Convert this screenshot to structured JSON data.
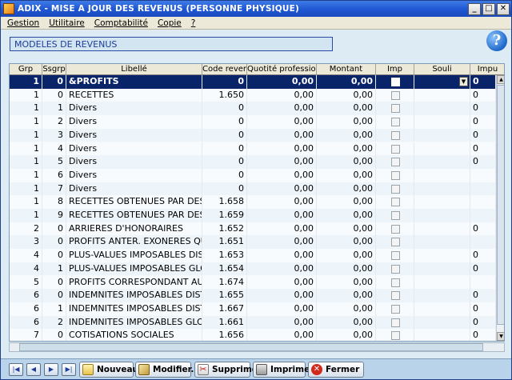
{
  "window": {
    "title": "ADIX - MISE A JOUR DES REVENUS (PERSONNE PHYSIQUE)",
    "minimize": "_",
    "maximize": "□",
    "close": "✕"
  },
  "menu": [
    "Gestion",
    "Utilitaire",
    "Comptabilité",
    "Copie",
    "?"
  ],
  "section_title": "MODELES DE REVENUS",
  "help_glyph": "?",
  "grid": {
    "columns": [
      "Grp",
      "Ssgrp",
      "Libellé",
      "Code revenu",
      "Quotité professionnelle",
      "Montant",
      "Imp",
      "Souli",
      "Impu"
    ],
    "rows": [
      {
        "grp": "1",
        "ssgrp": "0",
        "libelle": "&PROFITS",
        "code": "0",
        "quotite": "0,00",
        "montant": "0,00",
        "imp": false,
        "souli": "",
        "impu": "0",
        "selected": true
      },
      {
        "grp": "1",
        "ssgrp": "0",
        "libelle": "RECETTES",
        "code": "1.650",
        "quotite": "0,00",
        "montant": "0,00",
        "imp": false,
        "souli": "",
        "impu": "0"
      },
      {
        "grp": "1",
        "ssgrp": "1",
        "libelle": "Divers",
        "code": "0",
        "quotite": "0,00",
        "montant": "0,00",
        "imp": false,
        "souli": "",
        "impu": "0"
      },
      {
        "grp": "1",
        "ssgrp": "2",
        "libelle": "Divers",
        "code": "0",
        "quotite": "0,00",
        "montant": "0,00",
        "imp": false,
        "souli": "",
        "impu": "0"
      },
      {
        "grp": "1",
        "ssgrp": "3",
        "libelle": "Divers",
        "code": "0",
        "quotite": "0,00",
        "montant": "0,00",
        "imp": false,
        "souli": "",
        "impu": "0"
      },
      {
        "grp": "1",
        "ssgrp": "4",
        "libelle": "Divers",
        "code": "0",
        "quotite": "0,00",
        "montant": "0,00",
        "imp": false,
        "souli": "",
        "impu": "0"
      },
      {
        "grp": "1",
        "ssgrp": "5",
        "libelle": "Divers",
        "code": "0",
        "quotite": "0,00",
        "montant": "0,00",
        "imp": false,
        "souli": "",
        "impu": "0"
      },
      {
        "grp": "1",
        "ssgrp": "6",
        "libelle": "Divers",
        "code": "0",
        "quotite": "0,00",
        "montant": "0,00",
        "imp": false,
        "souli": "",
        "impu": ""
      },
      {
        "grp": "1",
        "ssgrp": "7",
        "libelle": "Divers",
        "code": "0",
        "quotite": "0,00",
        "montant": "0,00",
        "imp": false,
        "souli": "",
        "impu": ""
      },
      {
        "grp": "1",
        "ssgrp": "8",
        "libelle": "RECETTES OBTENUES PAR DES",
        "code": "1.658",
        "quotite": "0,00",
        "montant": "0,00",
        "imp": false,
        "souli": "",
        "impu": ""
      },
      {
        "grp": "1",
        "ssgrp": "9",
        "libelle": "RECETTES OBTENUES PAR DES",
        "code": "1.659",
        "quotite": "0,00",
        "montant": "0,00",
        "imp": false,
        "souli": "",
        "impu": ""
      },
      {
        "grp": "2",
        "ssgrp": "0",
        "libelle": "ARRIERES D'HONORAIRES",
        "code": "1.652",
        "quotite": "0,00",
        "montant": "0,00",
        "imp": false,
        "souli": "",
        "impu": "0"
      },
      {
        "grp": "3",
        "ssgrp": "0",
        "libelle": "PROFITS ANTER. EXONERES QU",
        "code": "1.651",
        "quotite": "0,00",
        "montant": "0,00",
        "imp": false,
        "souli": "",
        "impu": ""
      },
      {
        "grp": "4",
        "ssgrp": "0",
        "libelle": "PLUS-VALUES IMPOSABLES DIST",
        "code": "1.653",
        "quotite": "0,00",
        "montant": "0,00",
        "imp": false,
        "souli": "",
        "impu": "0"
      },
      {
        "grp": "4",
        "ssgrp": "1",
        "libelle": "PLUS-VALUES IMPOSABLES GLO",
        "code": "1.654",
        "quotite": "0,00",
        "montant": "0,00",
        "imp": false,
        "souli": "",
        "impu": "0"
      },
      {
        "grp": "5",
        "ssgrp": "0",
        "libelle": "PROFITS CORRESPONDANT AU",
        "code": "1.674",
        "quotite": "0,00",
        "montant": "0,00",
        "imp": false,
        "souli": "",
        "impu": ""
      },
      {
        "grp": "6",
        "ssgrp": "0",
        "libelle": "INDEMNITES IMPOSABLES DISTI",
        "code": "1.655",
        "quotite": "0,00",
        "montant": "0,00",
        "imp": false,
        "souli": "",
        "impu": "0"
      },
      {
        "grp": "6",
        "ssgrp": "1",
        "libelle": "INDEMNITES IMPOSABLES DISTI",
        "code": "1.667",
        "quotite": "0,00",
        "montant": "0,00",
        "imp": false,
        "souli": "",
        "impu": "0"
      },
      {
        "grp": "6",
        "ssgrp": "2",
        "libelle": "INDEMNITES IMPOSABLES GLOB",
        "code": "1.661",
        "quotite": "0,00",
        "montant": "0,00",
        "imp": false,
        "souli": "",
        "impu": "0"
      },
      {
        "grp": "7",
        "ssgrp": "0",
        "libelle": "COTISATIONS SOCIALES",
        "code": "1.656",
        "quotite": "0,00",
        "montant": "0,00",
        "imp": false,
        "souli": "",
        "impu": "0"
      }
    ]
  },
  "nav": {
    "first": "|◀",
    "prev": "◀",
    "next": "▶",
    "last": "▶|"
  },
  "buttons": {
    "new": "Nouveau...",
    "modify": "Modifier...",
    "delete": "Supprimer",
    "print": "Imprimer...",
    "close": "Fermer"
  },
  "colors": {
    "selection": "#0a246a",
    "accent": "#1b3c99",
    "close_red": "#d32a1e"
  }
}
